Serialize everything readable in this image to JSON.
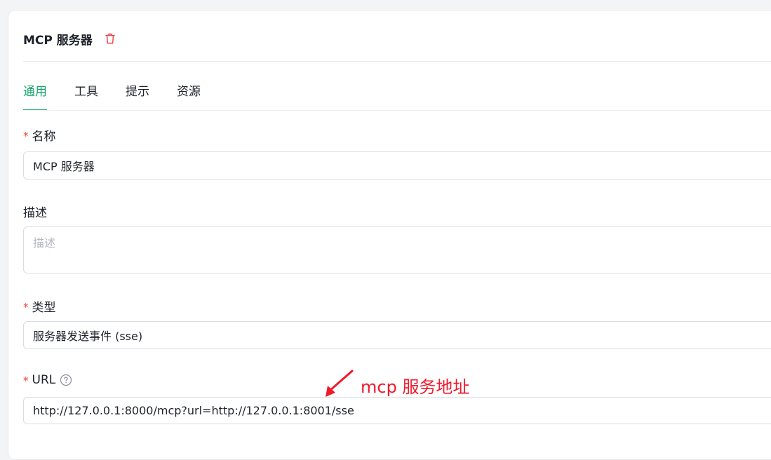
{
  "header": {
    "title": "MCP 服务器",
    "delete_icon": "trash-icon"
  },
  "tabs": [
    {
      "label": "通用",
      "active": true
    },
    {
      "label": "工具",
      "active": false
    },
    {
      "label": "提示",
      "active": false
    },
    {
      "label": "资源",
      "active": false
    }
  ],
  "form": {
    "name": {
      "label": "名称",
      "required": true,
      "value": "MCP 服务器"
    },
    "description": {
      "label": "描述",
      "required": false,
      "placeholder": "描述"
    },
    "type": {
      "label": "类型",
      "required": true,
      "value": "服务器发送事件 (sse)"
    },
    "url": {
      "label": "URL",
      "required": true,
      "help_icon": "question-circle-icon",
      "value": "http://127.0.0.1:8000/mcp?url=http://127.0.0.1:8001/sse"
    }
  },
  "annotation": {
    "text": "mcp 服务地址",
    "color": "#f0192a"
  },
  "colors": {
    "accent": "#12a16b",
    "required": "#f04134",
    "delete": "#e5484d"
  }
}
